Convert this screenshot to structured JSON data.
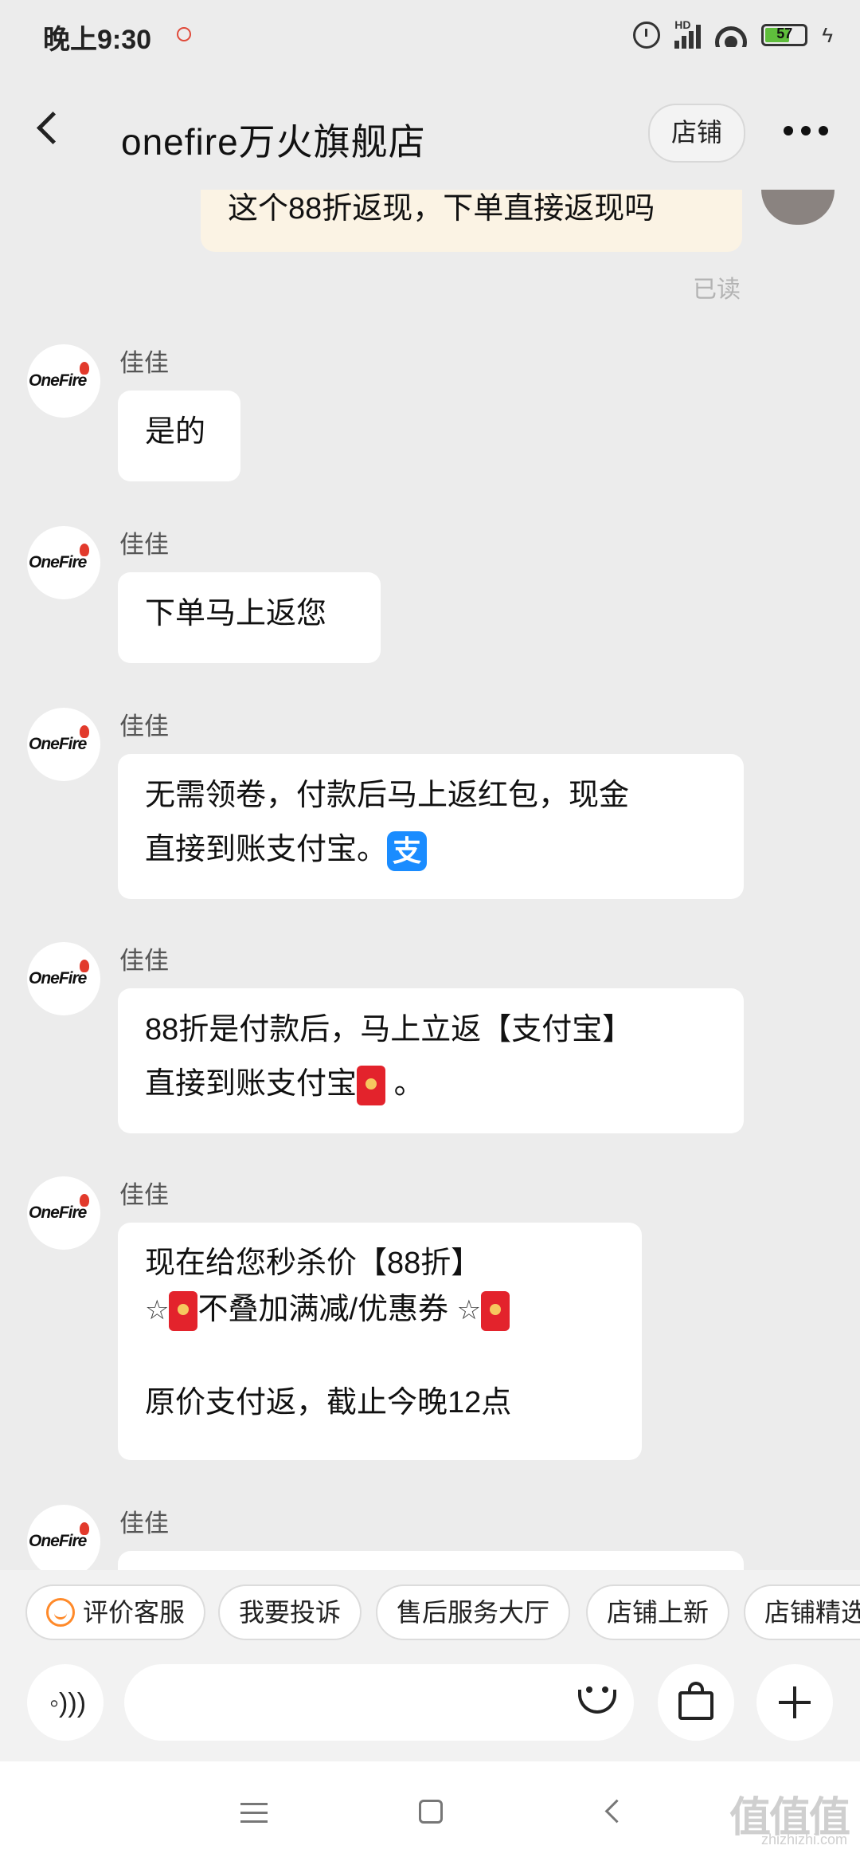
{
  "status_bar": {
    "time": "晚上9:30",
    "hd": "HD",
    "battery": "57",
    "accent_red": "#e04a3a"
  },
  "header": {
    "title": "onefire万火旗舰店",
    "shop_button": "店铺"
  },
  "chat": {
    "my_message": "这个88折返现，下单直接返现吗",
    "read_status": "已读",
    "avatar_logo": "OneFire",
    "messages": [
      {
        "sender": "佳佳",
        "text": "是的"
      },
      {
        "sender": "佳佳",
        "text": "下单马上返您"
      },
      {
        "sender": "佳佳",
        "line1": "无需领卷，付款后马上返红包，现金",
        "line2": "直接到账支付宝。"
      },
      {
        "sender": "佳佳",
        "line1": "88折是付款后，马上立返【支付宝】",
        "line2": "直接到账支付宝",
        "line2_tail": "。"
      },
      {
        "sender": "佳佳",
        "line1": "现在给您秒杀价【88折】",
        "line2_mid": "不叠加满减/优惠券",
        "star": "☆",
        "line4": "原价支付返，截止今晚12点"
      },
      {
        "sender": "佳佳"
      }
    ]
  },
  "quick_replies": [
    "评价客服",
    "我要投诉",
    "售后服务大厅",
    "店铺上新",
    "店铺精选"
  ],
  "input": {
    "placeholder": ""
  },
  "watermark": {
    "main": "值值值",
    "sub": "zhizhizhi.com"
  },
  "colors": {
    "bubble_me": "#fbf3e4",
    "bubble_other": "#ffffff",
    "background": "#ececec",
    "alipay": "#1a8cff",
    "red_packet": "#e3232c"
  }
}
